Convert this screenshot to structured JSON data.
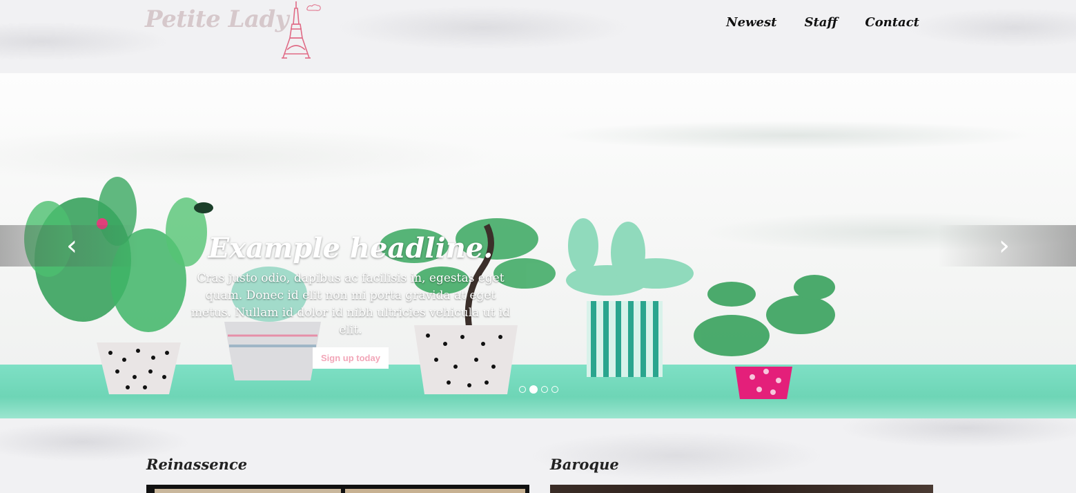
{
  "header": {
    "logo_text": "Petite Lady",
    "logo_icon": "eiffel-tower-icon",
    "nav": [
      {
        "label": "Newest"
      },
      {
        "label": "Staff"
      },
      {
        "label": "Contact"
      }
    ]
  },
  "carousel": {
    "headline": "Example headline.",
    "body": "Cras justo odio, dapibus ac facilisis in, egestas eget quam. Donec id elit non mi porta gravida at eget metus. Nullam id dolor id nibh ultricies vehicula ut id elit.",
    "button_label": "Sign up today",
    "prev_icon": "chevron-left-icon",
    "next_icon": "chevron-right-icon",
    "slide_count": 4,
    "active_slide": 2
  },
  "sections": [
    {
      "title": "Reinassence"
    },
    {
      "title": "Baroque"
    }
  ],
  "colors": {
    "accent": "#f2a6b8",
    "logo": "#d6c8cb",
    "ground": "#6ed5b6"
  }
}
